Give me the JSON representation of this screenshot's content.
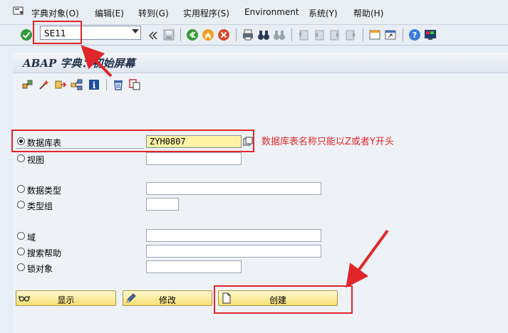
{
  "menu": {
    "items": [
      "字典对象(O)",
      "编辑(E)",
      "转到(G)",
      "实用程序(S)",
      "Environment",
      "系统(Y)",
      "帮助(H)"
    ]
  },
  "toolbar": {
    "command_value": "SE11"
  },
  "screen": {
    "title": "ABAP 字典：初始屏幕"
  },
  "options": [
    {
      "label": "数据库表",
      "selected": true,
      "value": "ZYH0807"
    },
    {
      "label": "视图",
      "selected": false,
      "value": ""
    },
    {
      "label": "数据类型",
      "selected": false,
      "value": ""
    },
    {
      "label": "类型组",
      "selected": false,
      "value": ""
    },
    {
      "label": "域",
      "selected": false,
      "value": ""
    },
    {
      "label": "搜索帮助",
      "selected": false,
      "value": ""
    },
    {
      "label": "锁对象",
      "selected": false,
      "value": ""
    }
  ],
  "buttons": {
    "display": "显示",
    "change": "修改",
    "create": "创建"
  },
  "annotation": {
    "note": "数据库表名称只能以Z或者Y开头"
  },
  "colors": {
    "highlight": "#e0262a",
    "input_highlight": "#fdf3a6",
    "button": "#f5df73"
  }
}
